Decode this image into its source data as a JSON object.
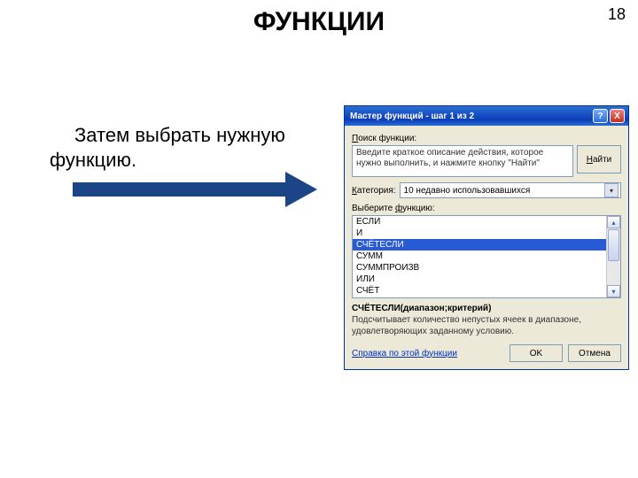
{
  "page_number": "18",
  "title": "ФУНКЦИИ",
  "caption_line1": "Затем выбрать нужную",
  "caption_line2": "функцию.",
  "dialog": {
    "title": "Мастер функций - шаг 1 из 2",
    "search_label": "Поиск функции:",
    "search_placeholder": "Введите краткое описание действия, которое нужно выполнить, и нажмите кнопку \"Найти\"",
    "find_button": "Найти",
    "category_label": "Категория:",
    "category_value": "10 недавно использовавшихся",
    "select_function_label": "Выберите функцию:",
    "functions": [
      "ЕСЛИ",
      "И",
      "СЧЁТЕСЛИ",
      "СУММ",
      "СУММПРОИЗВ",
      "ИЛИ",
      "СЧЁТ"
    ],
    "selected_index": 2,
    "syntax": "СЧЁТЕСЛИ(диапазон;критерий)",
    "description": "Подсчитывает количество непустых ячеек в диапазоне, удовлетворяющих заданному условию.",
    "help_link": "Справка по этой функции",
    "ok": "OK",
    "cancel": "Отмена"
  }
}
